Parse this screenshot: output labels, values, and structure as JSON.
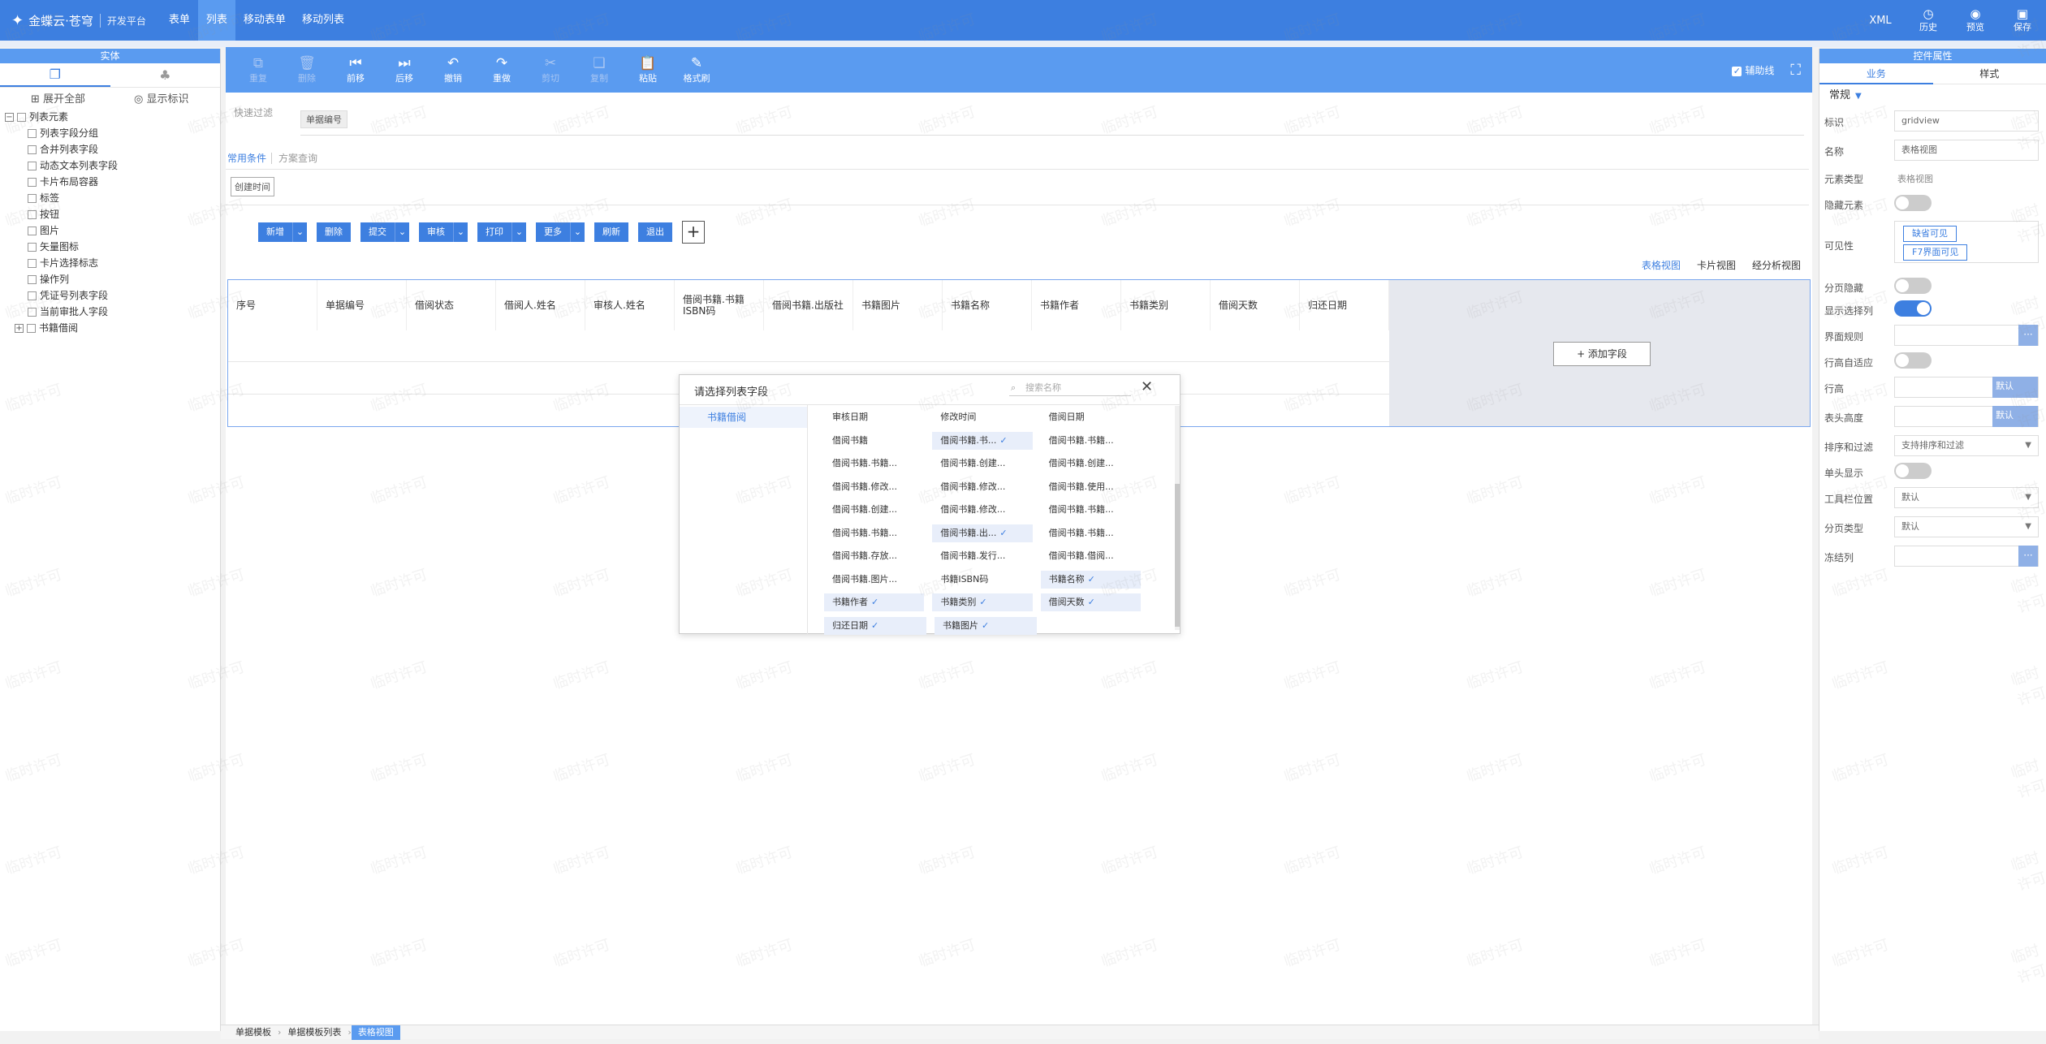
{
  "topbar": {
    "brand": "金蝶云·苍穹",
    "subtitle": "开发平台",
    "nav": [
      "表单",
      "列表",
      "移动表单",
      "移动列表"
    ],
    "active_nav": "列表",
    "right": {
      "xml": "XML",
      "items": [
        {
          "label": "历史",
          "icon": "history-icon"
        },
        {
          "label": "预览",
          "icon": "eye-icon"
        },
        {
          "label": "保存",
          "icon": "save-icon"
        }
      ]
    }
  },
  "left": {
    "title": "实体",
    "expand_all": "展开全部",
    "show_id": "显示标识",
    "tree_root": "列表元素",
    "tree_items": [
      "列表字段分组",
      "合并列表字段",
      "动态文本列表字段",
      "卡片布局容器",
      "标签",
      "按钮",
      "图片",
      "矢量图标",
      "卡片选择标志",
      "操作列",
      "凭证号列表字段",
      "当前审批人字段"
    ],
    "tree_last": "书籍借阅"
  },
  "toolbar": {
    "buttons": [
      {
        "label": "重复",
        "icon": "copy-icon",
        "enabled": false
      },
      {
        "label": "删除",
        "icon": "trash-icon",
        "enabled": false
      },
      {
        "label": "前移",
        "icon": "move-left-icon",
        "enabled": true
      },
      {
        "label": "后移",
        "icon": "move-right-icon",
        "enabled": true
      },
      {
        "label": "撤销",
        "icon": "undo-icon",
        "enabled": true
      },
      {
        "label": "重做",
        "icon": "redo-icon",
        "enabled": true
      },
      {
        "label": "剪切",
        "icon": "cut-icon",
        "enabled": false
      },
      {
        "label": "复制",
        "icon": "duplicate-icon",
        "enabled": false
      },
      {
        "label": "粘贴",
        "icon": "paste-icon",
        "enabled": true
      },
      {
        "label": "格式刷",
        "icon": "format-brush-icon",
        "enabled": true
      }
    ],
    "guide_line": "辅助线"
  },
  "filter": {
    "quick_filter": "快速过滤",
    "chip": "单据编号",
    "common_conditions": "常用条件",
    "scheme_query": "方案查询",
    "date_chip": "创建时间"
  },
  "action_buttons": [
    {
      "label": "新增",
      "dropdown": true
    },
    {
      "label": "删除",
      "dropdown": false
    },
    {
      "label": "提交",
      "dropdown": true
    },
    {
      "label": "审核",
      "dropdown": true
    },
    {
      "label": "打印",
      "dropdown": true
    },
    {
      "label": "更多",
      "dropdown": true
    },
    {
      "label": "刷新",
      "dropdown": false
    },
    {
      "label": "退出",
      "dropdown": false
    }
  ],
  "view_tabs": [
    "表格视图",
    "卡片视图",
    "经分析视图"
  ],
  "active_view": "表格视图",
  "grid": {
    "columns": [
      "序号",
      "单据编号",
      "借阅状态",
      "借阅人.姓名",
      "审核人.姓名",
      "借阅书籍.书籍ISBN码",
      "借阅书籍.出版社",
      "书籍图片",
      "书籍名称",
      "书籍作者",
      "书籍类别",
      "借阅天数",
      "归还日期"
    ],
    "add_field": "+ 添加字段"
  },
  "dialog": {
    "title": "请选择列表字段",
    "search_placeholder": "搜索名称",
    "category": "书籍借阅",
    "fields": [
      [
        {
          "t": "审核日期",
          "s": false
        },
        {
          "t": "修改时间",
          "s": false
        },
        {
          "t": "借阅日期",
          "s": false
        }
      ],
      [
        {
          "t": "借阅书籍",
          "s": false
        },
        {
          "t": "借阅书籍.书...",
          "s": true
        },
        {
          "t": "借阅书籍.书籍...",
          "s": false
        }
      ],
      [
        {
          "t": "借阅书籍.书籍...",
          "s": false
        },
        {
          "t": "借阅书籍.创建...",
          "s": false
        },
        {
          "t": "借阅书籍.创建...",
          "s": false
        }
      ],
      [
        {
          "t": "借阅书籍.修改...",
          "s": false
        },
        {
          "t": "借阅书籍.修改...",
          "s": false
        },
        {
          "t": "借阅书籍.使用...",
          "s": false
        }
      ],
      [
        {
          "t": "借阅书籍.创建...",
          "s": false
        },
        {
          "t": "借阅书籍.修改...",
          "s": false
        },
        {
          "t": "借阅书籍.书籍...",
          "s": false
        }
      ],
      [
        {
          "t": "借阅书籍.书籍...",
          "s": false
        },
        {
          "t": "借阅书籍.出...",
          "s": true
        },
        {
          "t": "借阅书籍.书籍...",
          "s": false
        }
      ],
      [
        {
          "t": "借阅书籍.存放...",
          "s": false
        },
        {
          "t": "借阅书籍.发行...",
          "s": false
        },
        {
          "t": "借阅书籍.借阅...",
          "s": false
        }
      ],
      [
        {
          "t": "借阅书籍.图片...",
          "s": false
        },
        {
          "t": "书籍ISBN码",
          "s": false
        },
        {
          "t": "书籍名称",
          "s": true
        }
      ],
      [
        {
          "t": "书籍作者",
          "s": true
        },
        {
          "t": "书籍类别",
          "s": true
        },
        {
          "t": "借阅天数",
          "s": true
        }
      ],
      [
        {
          "t": "归还日期",
          "s": true
        },
        {
          "t": "书籍图片",
          "s": true
        }
      ]
    ]
  },
  "right": {
    "title": "控件属性",
    "tabs": [
      "业务",
      "样式"
    ],
    "group": "常规",
    "props": {
      "id_label": "标识",
      "id_value": "gridview",
      "name_label": "名称",
      "name_value": "表格视图",
      "type_label": "元素类型",
      "type_value": "表格视图",
      "hidden_label": "隐藏元素",
      "visible_label": "可见性",
      "visible_tag1": "缺省可见",
      "visible_tag2": "F7界面可见",
      "page_hide_label": "分页隐藏",
      "show_select_label": "显示选择列",
      "ui_rule_label": "界面规则",
      "row_auto_label": "行高自适应",
      "row_height_label": "行高",
      "row_height_default": "默认",
      "header_height_label": "表头高度",
      "header_height_default": "默认",
      "sort_label": "排序和过滤",
      "sort_value": "支持排序和过滤",
      "single_head_label": "单头显示",
      "toolbar_pos_label": "工具栏位置",
      "toolbar_pos_value": "默认",
      "page_type_label": "分页类型",
      "page_type_value": "默认",
      "freeze_label": "冻结列"
    }
  },
  "breadcrumb": [
    "单据模板",
    "单据模板列表",
    "表格视图"
  ],
  "watermark_text": "临时许可"
}
